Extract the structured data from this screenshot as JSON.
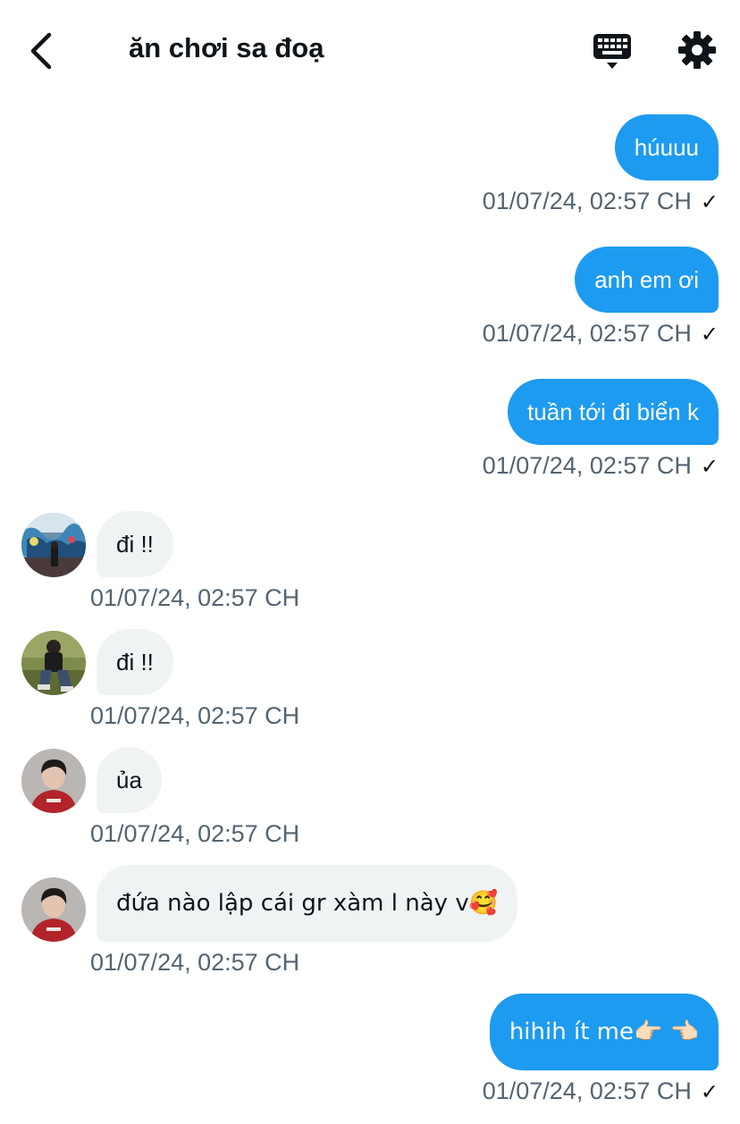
{
  "header": {
    "title": "ăn chơi sa đoạ"
  },
  "colors": {
    "outgoing_bubble": "#1d9bf0",
    "incoming_bubble": "#eff3f4",
    "timestamp": "#536471"
  },
  "messages": [
    {
      "direction": "out",
      "text": "húuuu",
      "timestamp": "01/07/24, 02:57 CH",
      "read_mark": "✓"
    },
    {
      "direction": "out",
      "text": "anh em ơi",
      "timestamp": "01/07/24, 02:57 CH",
      "read_mark": "✓"
    },
    {
      "direction": "out",
      "text": "tuần tới đi biển k",
      "timestamp": "01/07/24, 02:57 CH",
      "read_mark": "✓"
    },
    {
      "direction": "in",
      "text": "đi !!",
      "timestamp": "01/07/24, 02:57 CH",
      "avatar": "avatar-graffiti"
    },
    {
      "direction": "in",
      "text": "đi !!",
      "timestamp": "01/07/24, 02:57 CH",
      "avatar": "avatar-grass"
    },
    {
      "direction": "in",
      "text": "ủa",
      "timestamp": "01/07/24, 02:57 CH",
      "avatar": "avatar-red-hoodie"
    },
    {
      "direction": "in",
      "text": "đứa nào lập cái gr xàm l này v🥰",
      "timestamp": "01/07/24, 02:57 CH",
      "avatar": "avatar-red-hoodie"
    },
    {
      "direction": "out",
      "text": "hihih ít me👉🏻 👈🏻",
      "timestamp": "01/07/24, 02:57 CH",
      "read_mark": "✓"
    }
  ]
}
